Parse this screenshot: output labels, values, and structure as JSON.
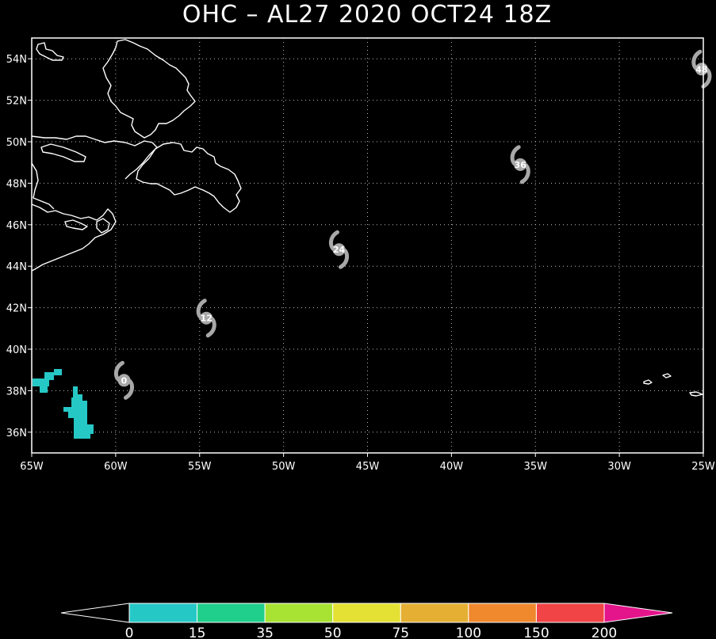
{
  "title": "OHC – AL27 2020 OCT24 18Z",
  "map": {
    "lon_range": [
      -65,
      -25
    ],
    "lat_range": [
      35,
      55
    ],
    "lon_ticks": [
      -65,
      -60,
      -55,
      -50,
      -45,
      -40,
      -35,
      -30,
      -25
    ],
    "lon_tick_labels": [
      "65W",
      "60W",
      "55W",
      "50W",
      "45W",
      "40W",
      "35W",
      "30W",
      "25W"
    ],
    "lat_ticks": [
      36,
      38,
      40,
      42,
      44,
      46,
      48,
      50,
      52,
      54
    ],
    "lat_tick_labels": [
      "36N",
      "38N",
      "40N",
      "42N",
      "44N",
      "46N",
      "48N",
      "50N",
      "52N",
      "54N"
    ],
    "grid": true,
    "background_color": "#000000",
    "coastline_color": "#ffffff",
    "storm_symbol_color": "#a8a8a8",
    "track_positions": [
      {
        "label": "0",
        "lon": -59.5,
        "lat": 38.5
      },
      {
        "label": "12",
        "lon": -54.6,
        "lat": 41.5
      },
      {
        "label": "24",
        "lon": -46.7,
        "lat": 44.8
      },
      {
        "label": "36",
        "lon": -35.9,
        "lat": 48.9
      },
      {
        "label": "48",
        "lon": -25.1,
        "lat": 53.5
      }
    ]
  },
  "colorbar": {
    "labels": [
      "0",
      "15",
      "35",
      "50",
      "75",
      "100",
      "150",
      "200"
    ],
    "colors": [
      "#26c8c6",
      "#20cf8c",
      "#a8e232",
      "#e4e034",
      "#e4af33",
      "#f0882e",
      "#f04446"
    ],
    "under_color": "#000000",
    "over_color": "#e4148a"
  }
}
